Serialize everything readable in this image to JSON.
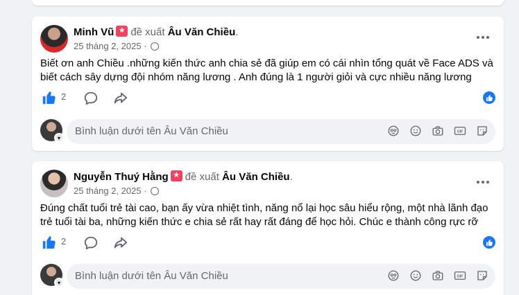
{
  "comments": [
    {
      "author": "Minh Vũ",
      "proposes_label": "đề xuất",
      "target": "Âu Văn Chiều",
      "target_suffix": ".",
      "date": "25 tháng 2, 2025",
      "body_line1": "Biết ơn anh Chiều .những kiến thức anh chia sẻ đã giúp em có cái nhìn tổng quát về Face ADS và",
      "body_line2": "biết cách sây dựng đội nhóm năng lương . Anh đúng là 1 người giỏi và cực nhiều năng lương",
      "like_count": "2",
      "comment_placeholder": "Bình luận dưới tên Âu Văn Chiều"
    },
    {
      "author": "Nguyễn Thuý Hằng",
      "proposes_label": "đề xuất",
      "target": "Âu Văn Chiều",
      "target_suffix": ".",
      "date": "25 tháng 2, 2025",
      "body_line1": "Đúng chất tuổi trẻ tài cao, bạn ấy vừa nhiệt tình, năng nổ lại học sâu hiểu rộng, một nhà lãnh đạo",
      "body_line2": "trẻ tuổi tài ba, những kiến thức e chia sẻ rất hay rất đáng để học hỏi. Chúc e thành công rực rỡ",
      "like_count": "2",
      "comment_placeholder": "Bình luận dưới tên Âu Văn Chiều"
    }
  ],
  "icons": {
    "like": "thumbs-up-icon",
    "comment": "comment-bubble-icon",
    "share": "share-arrow-icon",
    "globe": "public-globe-icon",
    "more": "more-options-icon",
    "sticker": "avatar-sticker-icon",
    "emoji": "emoji-icon",
    "camera": "camera-icon",
    "gif": "gif-icon",
    "stickers": "sticker-icon"
  },
  "colors": {
    "accent": "#1877f2",
    "recommend_badge": "#f3425f",
    "secondary_text": "#65676b"
  }
}
